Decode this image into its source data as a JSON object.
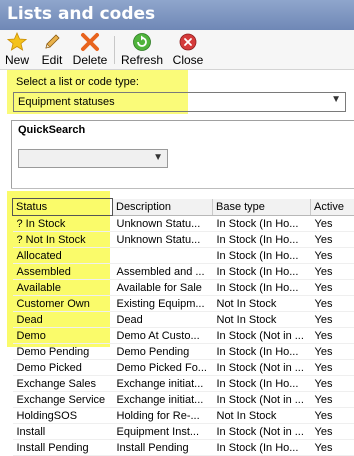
{
  "window": {
    "title": "Lists and codes"
  },
  "toolbar": {
    "buttons": [
      {
        "label": "New",
        "icon": "star-icon"
      },
      {
        "label": "Edit",
        "icon": "pencil-icon"
      },
      {
        "label": "Delete",
        "icon": "x-delete-icon"
      },
      {
        "label": "Refresh",
        "icon": "refresh-icon"
      },
      {
        "label": "Close",
        "icon": "close-circle-icon"
      }
    ]
  },
  "selector": {
    "label": "Select a list or code type:",
    "value": "Equipment statuses"
  },
  "quicksearch": {
    "label": "QuickSearch",
    "value": ""
  },
  "grid": {
    "columns": [
      "Status",
      "Description",
      "Base type",
      "Active"
    ],
    "rows": [
      [
        "? In Stock",
        "Unknown Statu...",
        "In Stock (In Ho...",
        "Yes"
      ],
      [
        "? Not In Stock",
        "Unknown Statu...",
        "In Stock (In Ho...",
        "Yes"
      ],
      [
        "Allocated",
        "",
        "In Stock (In Ho...",
        "Yes"
      ],
      [
        "Assembled",
        "Assembled and ...",
        "In Stock (In Ho...",
        "Yes"
      ],
      [
        "Available",
        "Available for Sale",
        "In Stock (In Ho...",
        "Yes"
      ],
      [
        "Customer Own",
        "Existing Equipm...",
        "Not In Stock",
        "Yes"
      ],
      [
        "Dead",
        "Dead",
        "Not In Stock",
        "Yes"
      ],
      [
        "Demo",
        "Demo At Custo...",
        "In Stock (Not in ...",
        "Yes"
      ],
      [
        "Demo Pending",
        "Demo Pending",
        "In Stock (In Ho...",
        "Yes"
      ],
      [
        "Demo Picked",
        "Demo Picked Fo...",
        "In Stock (Not in ...",
        "Yes"
      ],
      [
        "Exchange Sales",
        "Exchange initiat...",
        "In Stock (In Ho...",
        "Yes"
      ],
      [
        "Exchange Service",
        "Exchange initiat...",
        "In Stock (Not in ...",
        "Yes"
      ],
      [
        "HoldingSOS",
        "Holding for Re-...",
        "Not In Stock",
        "Yes"
      ],
      [
        "Install",
        "Equipment Inst...",
        "In Stock (Not in ...",
        "Yes"
      ],
      [
        "Install Pending",
        "Install Pending",
        "In Stock (In Ho...",
        "Yes"
      ]
    ]
  },
  "colors": {
    "titlebar": "#7c93bf",
    "highlight": "#fafb6a"
  }
}
